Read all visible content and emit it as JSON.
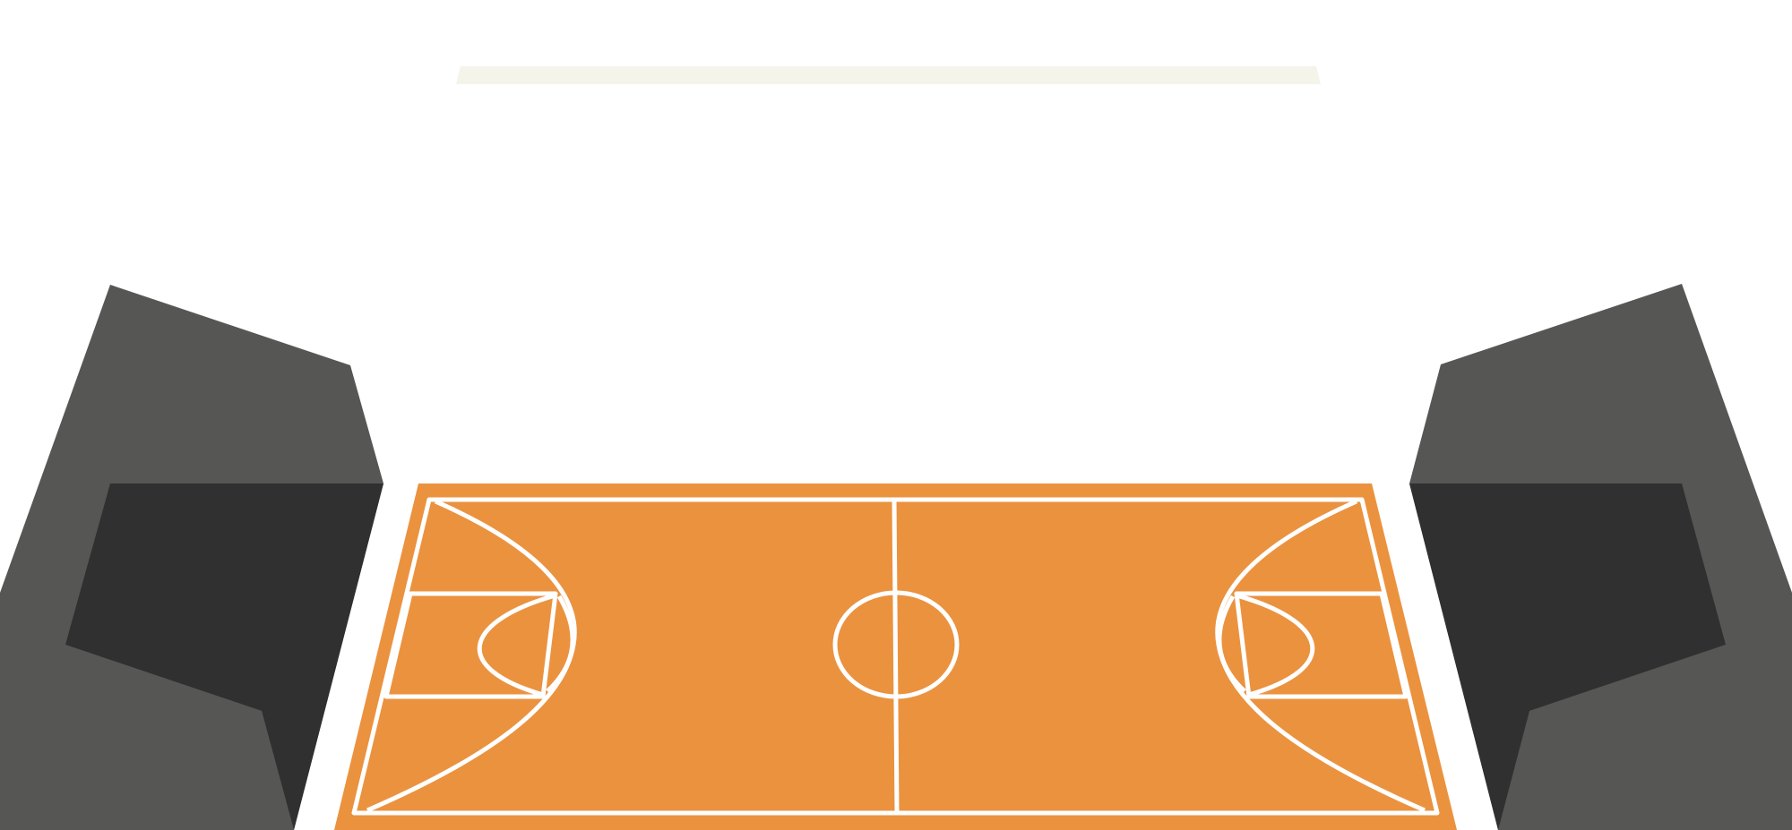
{
  "colors": {
    "background": "#ffffff",
    "stands_light": "#565654",
    "stands_dark": "#303030",
    "court_floor": "#eb923f",
    "court_lines": "#ffffff",
    "scoreboard_bar": "#f4f4ea"
  },
  "scene": {
    "elements": [
      "scoreboard-bar",
      "left-stands",
      "right-stands",
      "basketball-court",
      "center-circle",
      "half-court-line",
      "left-three-point-arc",
      "right-three-point-arc",
      "left-key",
      "right-key"
    ]
  }
}
